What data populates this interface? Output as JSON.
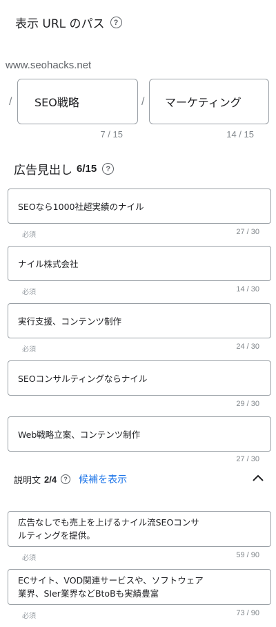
{
  "url_path": {
    "title": "表示 URL のパス",
    "help_glyph": "?",
    "domain": "www.seohacks.net",
    "separator": "/",
    "path1": {
      "value": "SEO戦略",
      "counter": "7 / 15"
    },
    "path2": {
      "value": "マーケティング",
      "counter": "14 / 15"
    }
  },
  "headlines": {
    "title": "広告見出し",
    "count": "6/15",
    "items": [
      {
        "value": "SEOなら1000社超実績のナイル",
        "required": "必須",
        "counter": "27 / 30"
      },
      {
        "value": "ナイル株式会社",
        "required": "必須",
        "counter": "14 / 30"
      },
      {
        "value": "実行支援、コンテンツ制作",
        "required": "必須",
        "counter": "24 / 30"
      },
      {
        "value": "SEOコンサルティングならナイル",
        "required": "",
        "counter": "29 / 30"
      },
      {
        "value": "Web戦略立案、コンテンツ制作",
        "required": "",
        "counter": "27 / 30"
      }
    ]
  },
  "descriptions": {
    "title": "説明文",
    "count": "2/4",
    "show_suggestions": "候補を表示",
    "items": [
      {
        "line1": "広告なしでも売上を上げるナイル流SEOコンサ",
        "line2": "ルティングを提供。",
        "required": "必須",
        "counter": "59 / 90"
      },
      {
        "line1": "ECサイト、VOD関連サービスや、ソフトウェア",
        "line2": "業界、SIer業界などBtoBも実績豊富",
        "required": "必須",
        "counter": "73 / 90"
      }
    ]
  },
  "colors": {
    "link": "#1a73e8",
    "border": "#9aa0a6",
    "muted": "#80868b"
  }
}
